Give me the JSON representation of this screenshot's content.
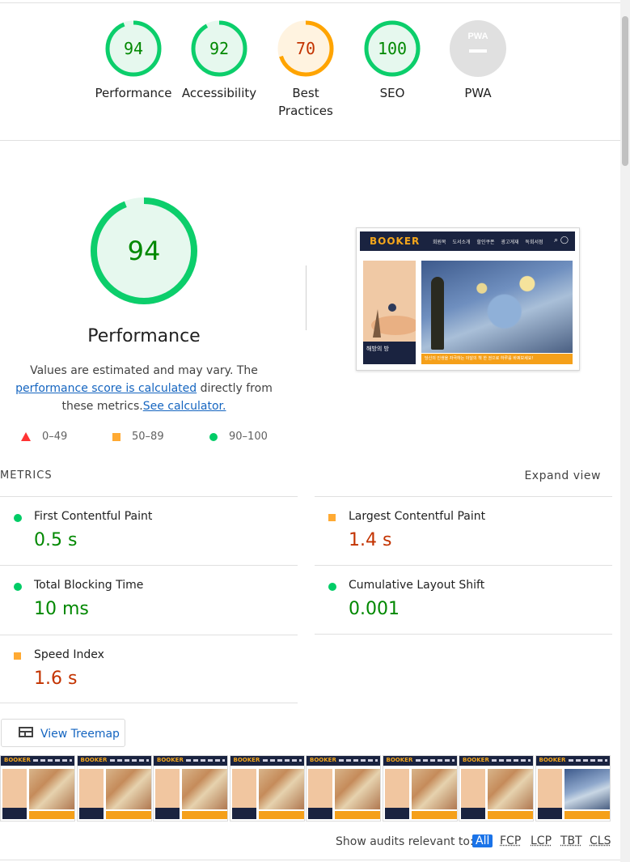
{
  "summary": [
    {
      "score": "94",
      "label": "Performance",
      "color": "#0cce6b",
      "bg": "#e6f8ee",
      "text_color": "#008800",
      "fill": 0.94
    },
    {
      "score": "92",
      "label": "Accessibility",
      "color": "#0cce6b",
      "bg": "#e6f8ee",
      "text_color": "#008800",
      "fill": 0.92
    },
    {
      "score": "70",
      "label_line1": "Best",
      "label_line2": "Practices",
      "color": "#ffa400",
      "bg": "#fff3e0",
      "text_color": "#c33300",
      "fill": 0.7
    },
    {
      "score": "100",
      "label": "SEO",
      "color": "#0cce6b",
      "bg": "#e6f8ee",
      "text_color": "#008800",
      "fill": 1.0
    },
    {
      "badge": "PWA",
      "label": "PWA",
      "color": "#e0e0e0"
    }
  ],
  "performance": {
    "score": "94",
    "fill": 0.94,
    "title": "Performance",
    "desc_prefix": "Values are estimated and may vary. The ",
    "desc_link1": "performance score is calculated",
    "desc_middle": " directly from these metrics.",
    "desc_link2": "See calculator."
  },
  "screenshot": {
    "logo": "BOOKER",
    "menu": "회원목 도서소개 할인쿠폰 광고게재 독회서점",
    "book_title": "해방의 방",
    "banner": "당신의 인생을 자극하는 이달의 책 한 권으로 하루를 바꿔보세요!"
  },
  "legend": [
    {
      "range": "0–49",
      "shape": "triangle"
    },
    {
      "range": "50–89",
      "shape": "square"
    },
    {
      "range": "90–100",
      "shape": "circle"
    }
  ],
  "metrics": {
    "header": "METRICS",
    "expand": "Expand view",
    "items": [
      {
        "name": "First Contentful Paint",
        "value": "0.5 s",
        "status": "pass"
      },
      {
        "name": "Largest Contentful Paint",
        "value": "1.4 s",
        "status": "average"
      },
      {
        "name": "Total Blocking Time",
        "value": "10 ms",
        "status": "pass"
      },
      {
        "name": "Cumulative Layout Shift",
        "value": "0.001",
        "status": "pass"
      },
      {
        "name": "Speed Index",
        "value": "1.6 s",
        "status": "average"
      }
    ]
  },
  "treemap": {
    "label": "View Treemap"
  },
  "filmstrip": {
    "logo": "BOOKER",
    "frames": 8
  },
  "filter": {
    "label": "Show audits relevant to:",
    "chips": [
      "All",
      "FCP",
      "LCP",
      "TBT",
      "CLS"
    ],
    "active": "All"
  }
}
